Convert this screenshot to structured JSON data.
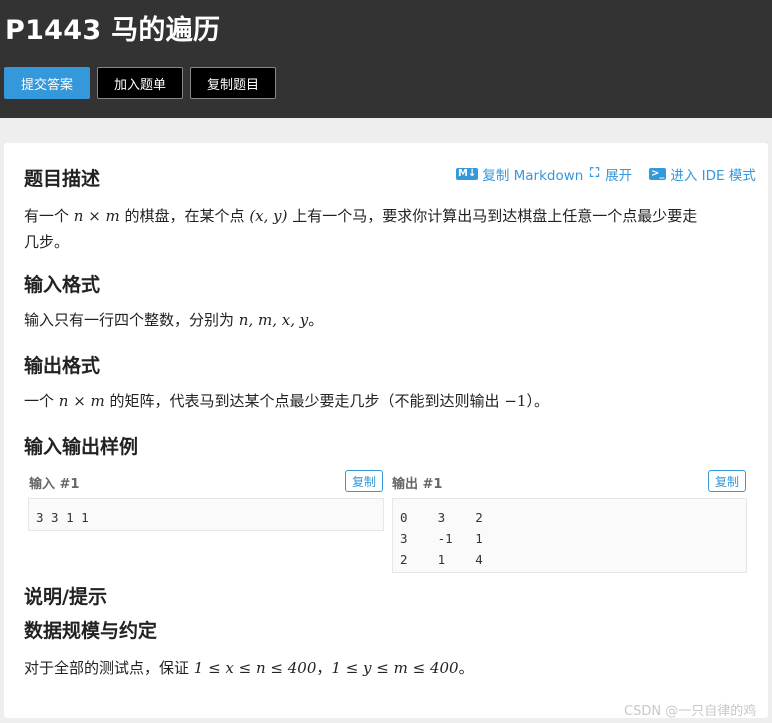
{
  "header": {
    "title": "P1443 马的遍历",
    "buttons": {
      "submit": "提交答案",
      "add_to_list": "加入题单",
      "copy_problem": "复制题目"
    }
  },
  "tools": {
    "copy_markdown": "复制 Markdown",
    "expand": "展开",
    "ide_mode": "进入 IDE 模式"
  },
  "sections": {
    "description_title": "题目描述",
    "description_parts": [
      "有一个 ",
      "n × m",
      " 的棋盘，在某个点 ",
      "(x, y)",
      " 上有一个马，要求你计算出马到达棋盘上任意一个点最少要走"
    ],
    "description_line2": "几步。",
    "input_title": "输入格式",
    "input_parts": [
      "输入只有一行四个整数，分别为 ",
      "n, m, x, y",
      "。"
    ],
    "output_title": "输出格式",
    "output_parts": [
      "一个 ",
      "n × m",
      " 的矩阵，代表马到达某个点最少要走几步（不能到达则输出 ",
      "−1",
      "）。"
    ],
    "samples_title": "输入输出样例",
    "hint_title": "说明/提示",
    "constraints_title": "数据规模与约定",
    "constraints_parts": [
      "对于全部的测试点，保证 ",
      "1 ≤ x ≤ n ≤ 400",
      "，",
      "1 ≤ y ≤ m ≤ 400",
      "。"
    ]
  },
  "samples": {
    "input_label": "输入 #1",
    "output_label": "输出 #1",
    "copy_label": "复制",
    "input_text": "3 3 1 1",
    "output_text": "0    3    2\n3    -1   1\n2    1    4"
  },
  "watermark": "CSDN @一只自律的鸡",
  "colors": {
    "header_bg": "#333333",
    "accent": "#3498db",
    "page_bg": "#eeeeee"
  }
}
